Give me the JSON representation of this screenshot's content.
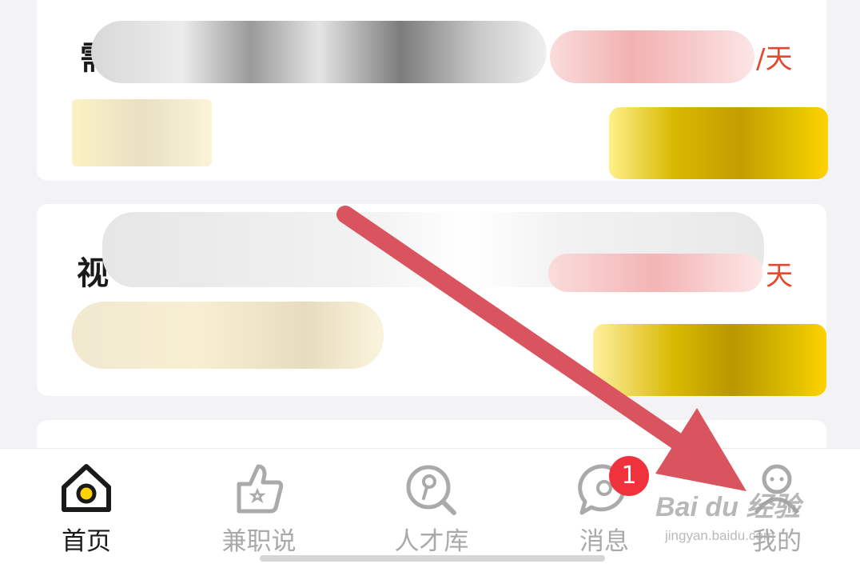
{
  "cards": [
    {
      "title_visible": "需",
      "salary_unit": "/天"
    },
    {
      "title_visible": "视",
      "salary_unit": "天"
    }
  ],
  "tabs": [
    {
      "label": "首页",
      "icon": "home-icon",
      "active": true
    },
    {
      "label": "兼职说",
      "icon": "thumbs-up-icon",
      "active": false
    },
    {
      "label": "人才库",
      "icon": "talent-search-icon",
      "active": false
    },
    {
      "label": "消息",
      "icon": "message-icon",
      "active": false
    },
    {
      "label": "我的",
      "icon": "profile-icon",
      "active": false
    }
  ],
  "message_badge": "1",
  "watermark": {
    "brand": "Bai du 经验",
    "url": "jingyan.baidu.com"
  },
  "colors": {
    "accent_yellow": "#ffd200",
    "salary_red": "#e2492f",
    "badge_red": "#f0323c",
    "arrow_red": "#d9545e"
  }
}
